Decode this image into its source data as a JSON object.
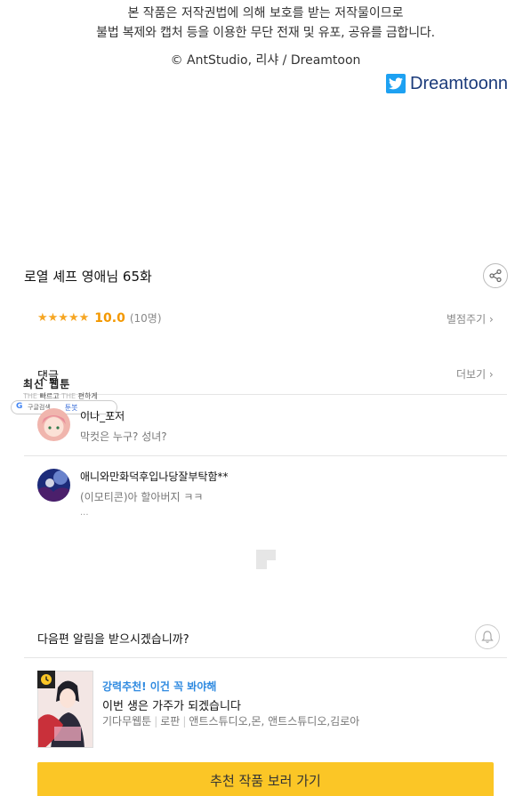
{
  "copyright": {
    "line1": "본 작품은 저작권법에 의해 보호를 받는 저작물이므로",
    "line2": "불법 복제와 캡처 등을 이용한 무단 전재 및 유포, 공유를 금합니다.",
    "credit": "© AntStudio, 리샤 / Dreamtoon"
  },
  "twitter": {
    "label": "Dreamtoonn",
    "icon": "twitter-icon",
    "color": "#1da1f2"
  },
  "episode": {
    "title": "로열 셰프 영애님 65화",
    "share_icon": "share-icon"
  },
  "rating": {
    "stars": "★★★★★",
    "score": "10.0",
    "count": "(10명)",
    "rate_link": "별점주기 ›"
  },
  "comments": {
    "header": "댓글",
    "more_link": "더보기 ›",
    "items": [
      {
        "author": "이나_포저",
        "text": "막컷은 누구? 성녀?",
        "more": ""
      },
      {
        "author": "애니와만화덕후입나당잘부탁함**",
        "text": "(이모티콘)아 할아버지 ㅋㅋ",
        "more": "..."
      }
    ]
  },
  "overlay": {
    "title": "최신 웹툰",
    "sub_prefix": "THE",
    "sub_fast": "빠르고",
    "sub_mid": "THE",
    "sub_easy": "편하게",
    "search_g": "G",
    "search_label": "구글검색",
    "search_tag": "툰봇"
  },
  "notify": {
    "question": "다음편 알림을 받으시겠습니까?",
    "bell_icon": "bell-icon"
  },
  "recommend": {
    "tag": "강력추천! 이건 꼭 봐야해",
    "title": "이번 생은 가주가 되겠습니다",
    "meta_source": "기다무웹툰",
    "meta_genre": "로판",
    "meta_authors": "앤트스튜디오,몬, 앤트스튜디오,김로아",
    "clock_icon": "clock-icon",
    "cta": "추천 작품 보러 가기",
    "cta_color": "#fbc626"
  },
  "colors": {
    "accent_orange": "#f39800",
    "star": "#f6a623",
    "link_blue": "#2f8ae0"
  }
}
